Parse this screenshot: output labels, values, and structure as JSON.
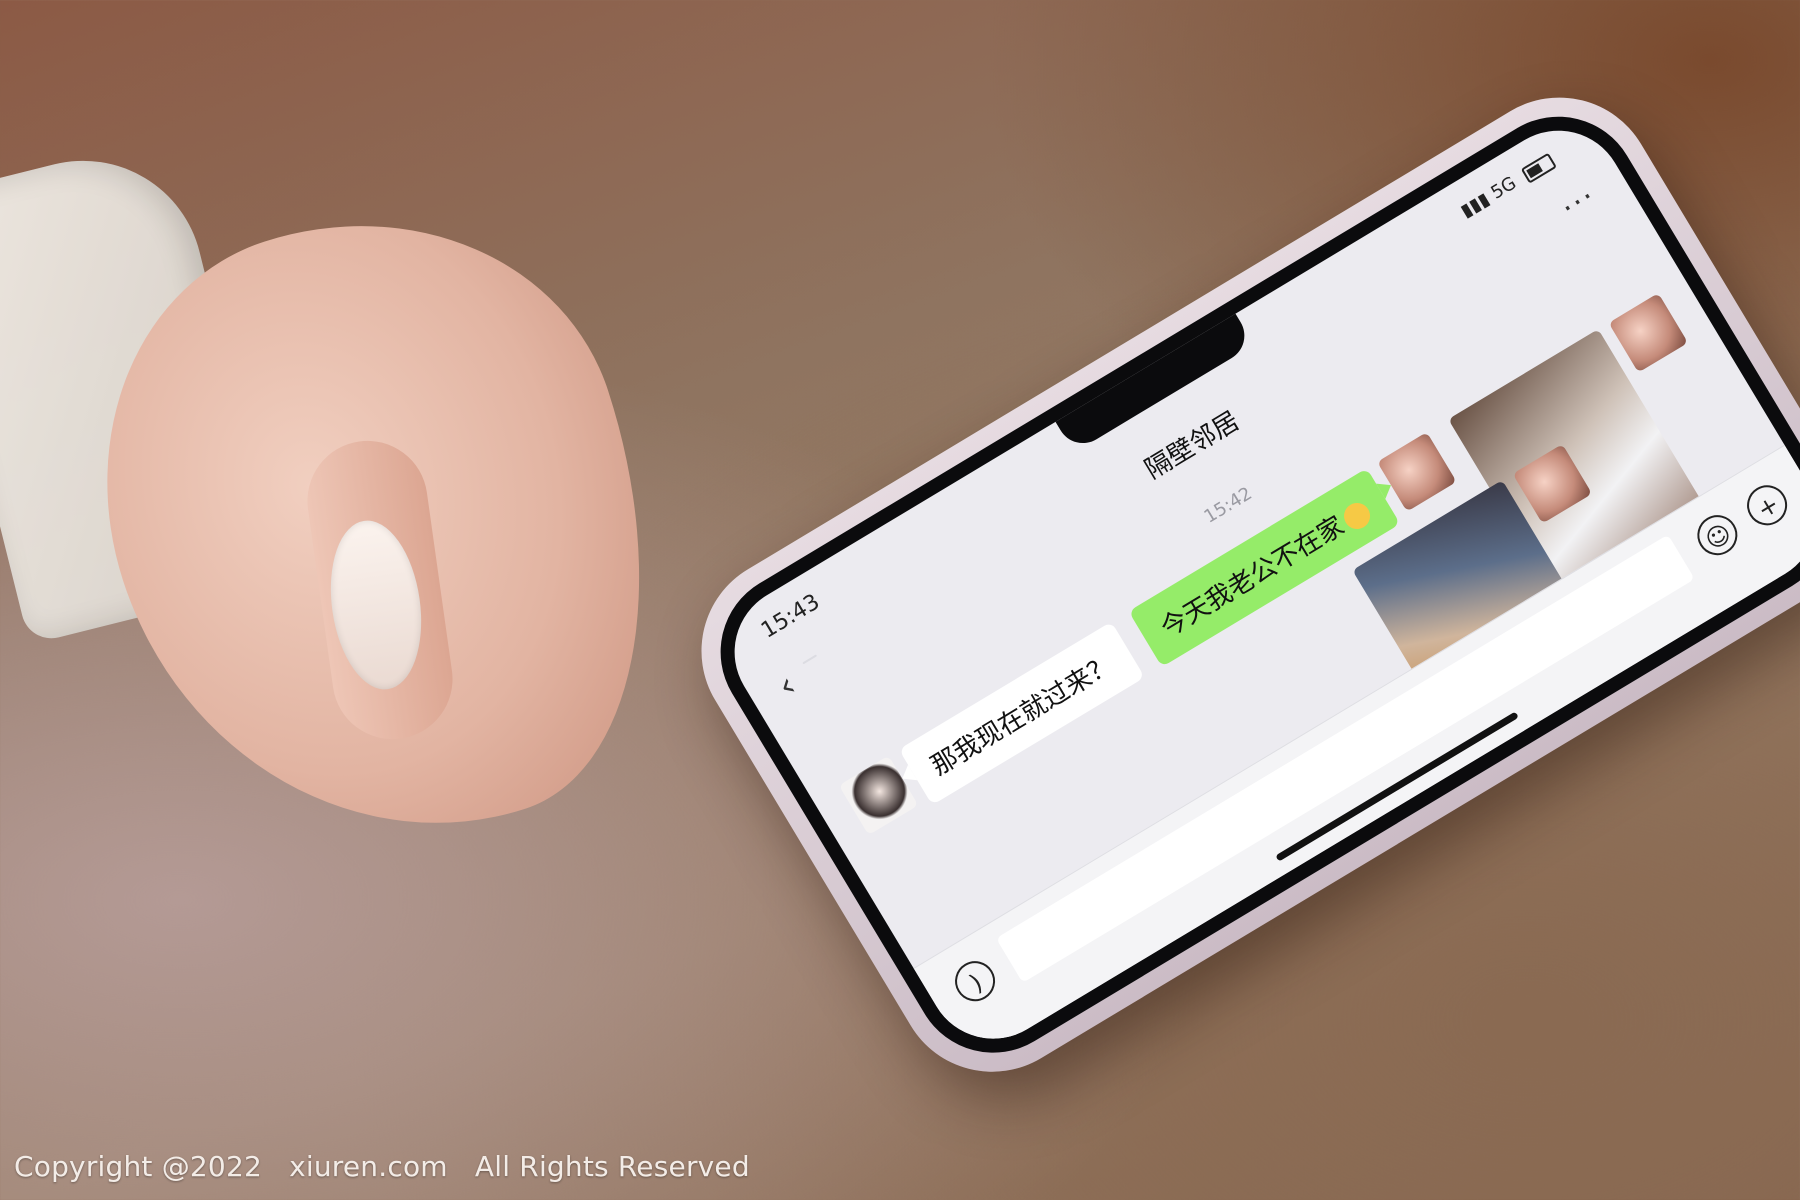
{
  "status_bar": {
    "time": "15:43",
    "network": "5G"
  },
  "chat": {
    "title": "隔壁邻居",
    "unread_badge": "",
    "timestamp": "15:42",
    "messages": [
      {
        "from": "me",
        "type": "image",
        "desc": "photo-1"
      },
      {
        "from": "me",
        "type": "image",
        "desc": "photo-2"
      },
      {
        "from": "me",
        "type": "text",
        "text": "今天我老公不在家"
      },
      {
        "from": "other",
        "type": "text",
        "text": "那我现在就过来？"
      }
    ]
  },
  "input_bar": {
    "placeholder": ""
  },
  "watermark": {
    "copyright": "Copyright @2022",
    "site": "xiuren.com",
    "rights": "All Rights Reserved"
  },
  "colors": {
    "my_bubble": "#95ec69",
    "other_bubble": "#ffffff",
    "screen_bg": "#ecebf0",
    "phone_case": "#e6dbe1"
  }
}
